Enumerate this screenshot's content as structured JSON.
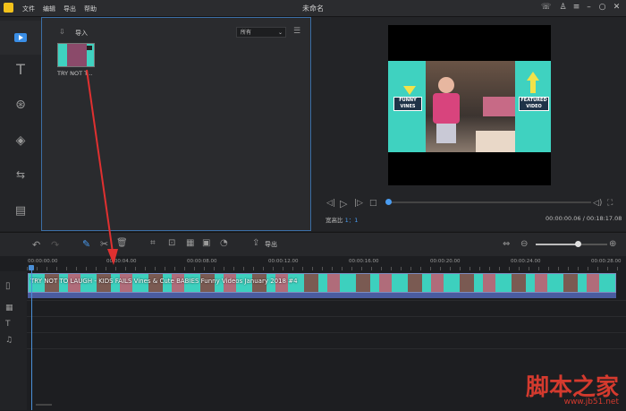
{
  "menu": {
    "items": [
      "文件",
      "编辑",
      "导出",
      "帮助"
    ],
    "title": "未命名"
  },
  "media": {
    "import_label": "导入",
    "filter_value": "所有",
    "clip_name": "TRY NOT T..."
  },
  "preview": {
    "labels": {
      "left": "FUNNY VINES",
      "right": "FEATURED VIDEO"
    },
    "aspect_label": "宽高比",
    "aspect_value": "1：1",
    "time": "00:00:00.06 / 00:18:17.08"
  },
  "timeline": {
    "export_label": "导出",
    "ticks": [
      "00:00:00.00",
      "00:00:04.00",
      "00:00:08.00",
      "00:00:12.00",
      "00:00:16.00",
      "00:00:20.00",
      "00:00:24.00",
      "00:00:28.00"
    ],
    "clip_title": "TRY NOT TO LAUGH - KIDS FAILS Vines & Cute BABIES Funny Videos January 2018 #4"
  },
  "watermark": {
    "main": "脚本之家",
    "url": "www.jb51.net"
  },
  "colors": {
    "accent": "#3c6fa6",
    "clip": "#3dd0be",
    "arrow": "#e03030"
  }
}
